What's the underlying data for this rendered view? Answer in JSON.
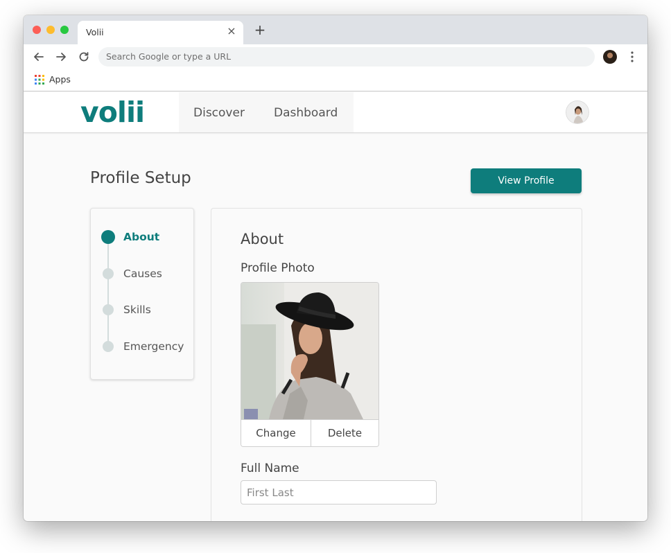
{
  "browser": {
    "tab_title": "Volii",
    "tab_close": "×",
    "new_tab": "+",
    "omnibox_placeholder": "Search Google or type a URL",
    "bookmarks": {
      "apps_label": "Apps"
    }
  },
  "site": {
    "logo": "volii",
    "brand_color": "#0e7d7c",
    "nav": {
      "discover": "Discover",
      "dashboard": "Dashboard"
    }
  },
  "page": {
    "title": "Profile Setup",
    "view_profile_button": "View Profile"
  },
  "steps": [
    {
      "label": "About",
      "active": true
    },
    {
      "label": "Causes",
      "active": false
    },
    {
      "label": "Skills",
      "active": false
    },
    {
      "label": "Emergency",
      "active": false
    }
  ],
  "form": {
    "section_title": "About",
    "profile_photo_label": "Profile Photo",
    "change_button": "Change",
    "delete_button": "Delete",
    "full_name_label": "Full Name",
    "full_name_placeholder": "First Last",
    "full_name_value": ""
  }
}
